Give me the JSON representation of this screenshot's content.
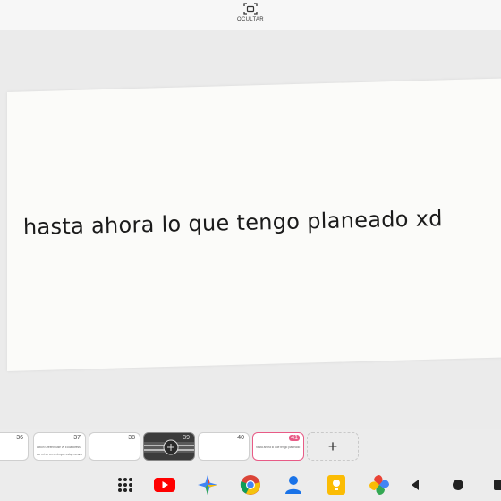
{
  "toolbar": {
    "hide_label": "OCULTAR"
  },
  "slide": {
    "text": "hasta ahora lo que tengo planeado xd"
  },
  "thumbnails": [
    {
      "number": "36",
      "lines": []
    },
    {
      "number": "37",
      "lines": [
        "action Greenhouse vs Ecoaddress",
        "ver mi en on vertn que estup veran on"
      ]
    },
    {
      "number": "38",
      "lines": []
    },
    {
      "number": "39",
      "lines": []
    },
    {
      "number": "40",
      "lines": []
    },
    {
      "number": "41",
      "lines": [
        "hasta ahora lo que tengo planeado xd"
      ]
    }
  ],
  "taskbar": {
    "apps": [
      "app-drawer",
      "youtube",
      "google-one",
      "chrome",
      "contacts",
      "keep-notes",
      "google-photos"
    ],
    "nav": [
      "back",
      "home",
      "recents"
    ]
  },
  "colors": {
    "selected_accent": "#e85b86",
    "slide_background": "#fbfbf9"
  }
}
